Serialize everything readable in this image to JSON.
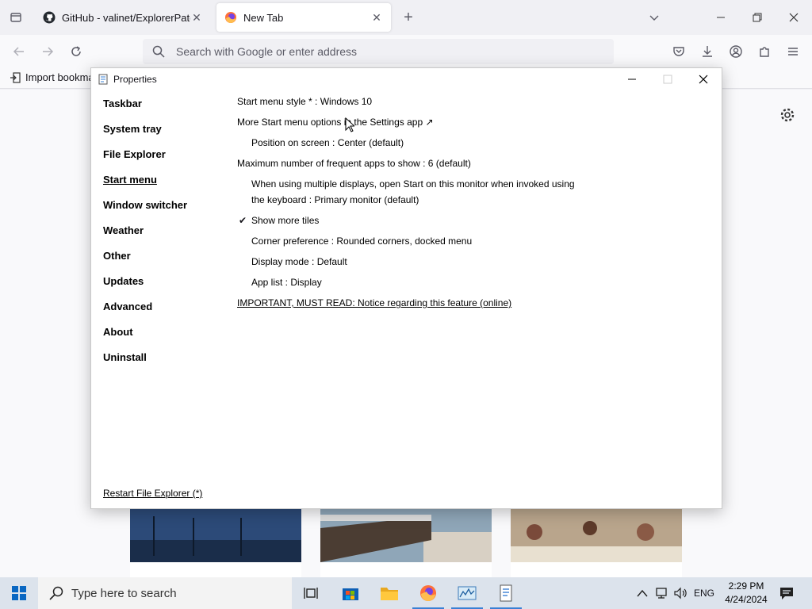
{
  "browser": {
    "tabs": [
      {
        "title": "GitHub - valinet/ExplorerPatcher",
        "active": false
      },
      {
        "title": "New Tab",
        "active": true
      }
    ],
    "urlbar_placeholder": "Search with Google or enter address",
    "bookmark_import_label": "Import bookmarks..."
  },
  "dialog": {
    "title": "Properties",
    "sidebar": [
      {
        "label": "Taskbar"
      },
      {
        "label": "System tray"
      },
      {
        "label": "File Explorer"
      },
      {
        "label": "Start menu",
        "selected": true
      },
      {
        "label": "Window switcher"
      },
      {
        "label": "Weather"
      },
      {
        "label": "Other"
      },
      {
        "label": "Updates"
      },
      {
        "label": "Advanced"
      },
      {
        "label": "About"
      },
      {
        "label": "Uninstall"
      }
    ],
    "options": {
      "start_menu_style": "Start menu style * : Windows 10",
      "more_options": "More Start menu options in the Settings app ↗",
      "position": "Position on screen : Center (default)",
      "max_frequent": "Maximum number of frequent apps to show : 6 (default)",
      "multi_display_line1": "When using multiple displays, open Start on this monitor when invoked using",
      "multi_display_line2": "the keyboard : Primary monitor (default)",
      "show_more_tiles": "Show more tiles",
      "show_more_tiles_checked": true,
      "corner_pref": "Corner preference : Rounded corners, docked menu",
      "display_mode": "Display mode : Default",
      "app_list": "App list : Display",
      "notice_link": "IMPORTANT, MUST READ: Notice regarding this feature (online)"
    },
    "checkmark": "✔",
    "restart_link": "Restart File Explorer (*)"
  },
  "taskbar": {
    "search_placeholder": "Type here to search",
    "language": "ENG",
    "time": "2:29 PM",
    "date": "4/24/2024"
  },
  "colors": {
    "accent": "#3a80d4",
    "taskbar_bg": "#dce3ec",
    "firefox_orange": "#ff7139"
  }
}
